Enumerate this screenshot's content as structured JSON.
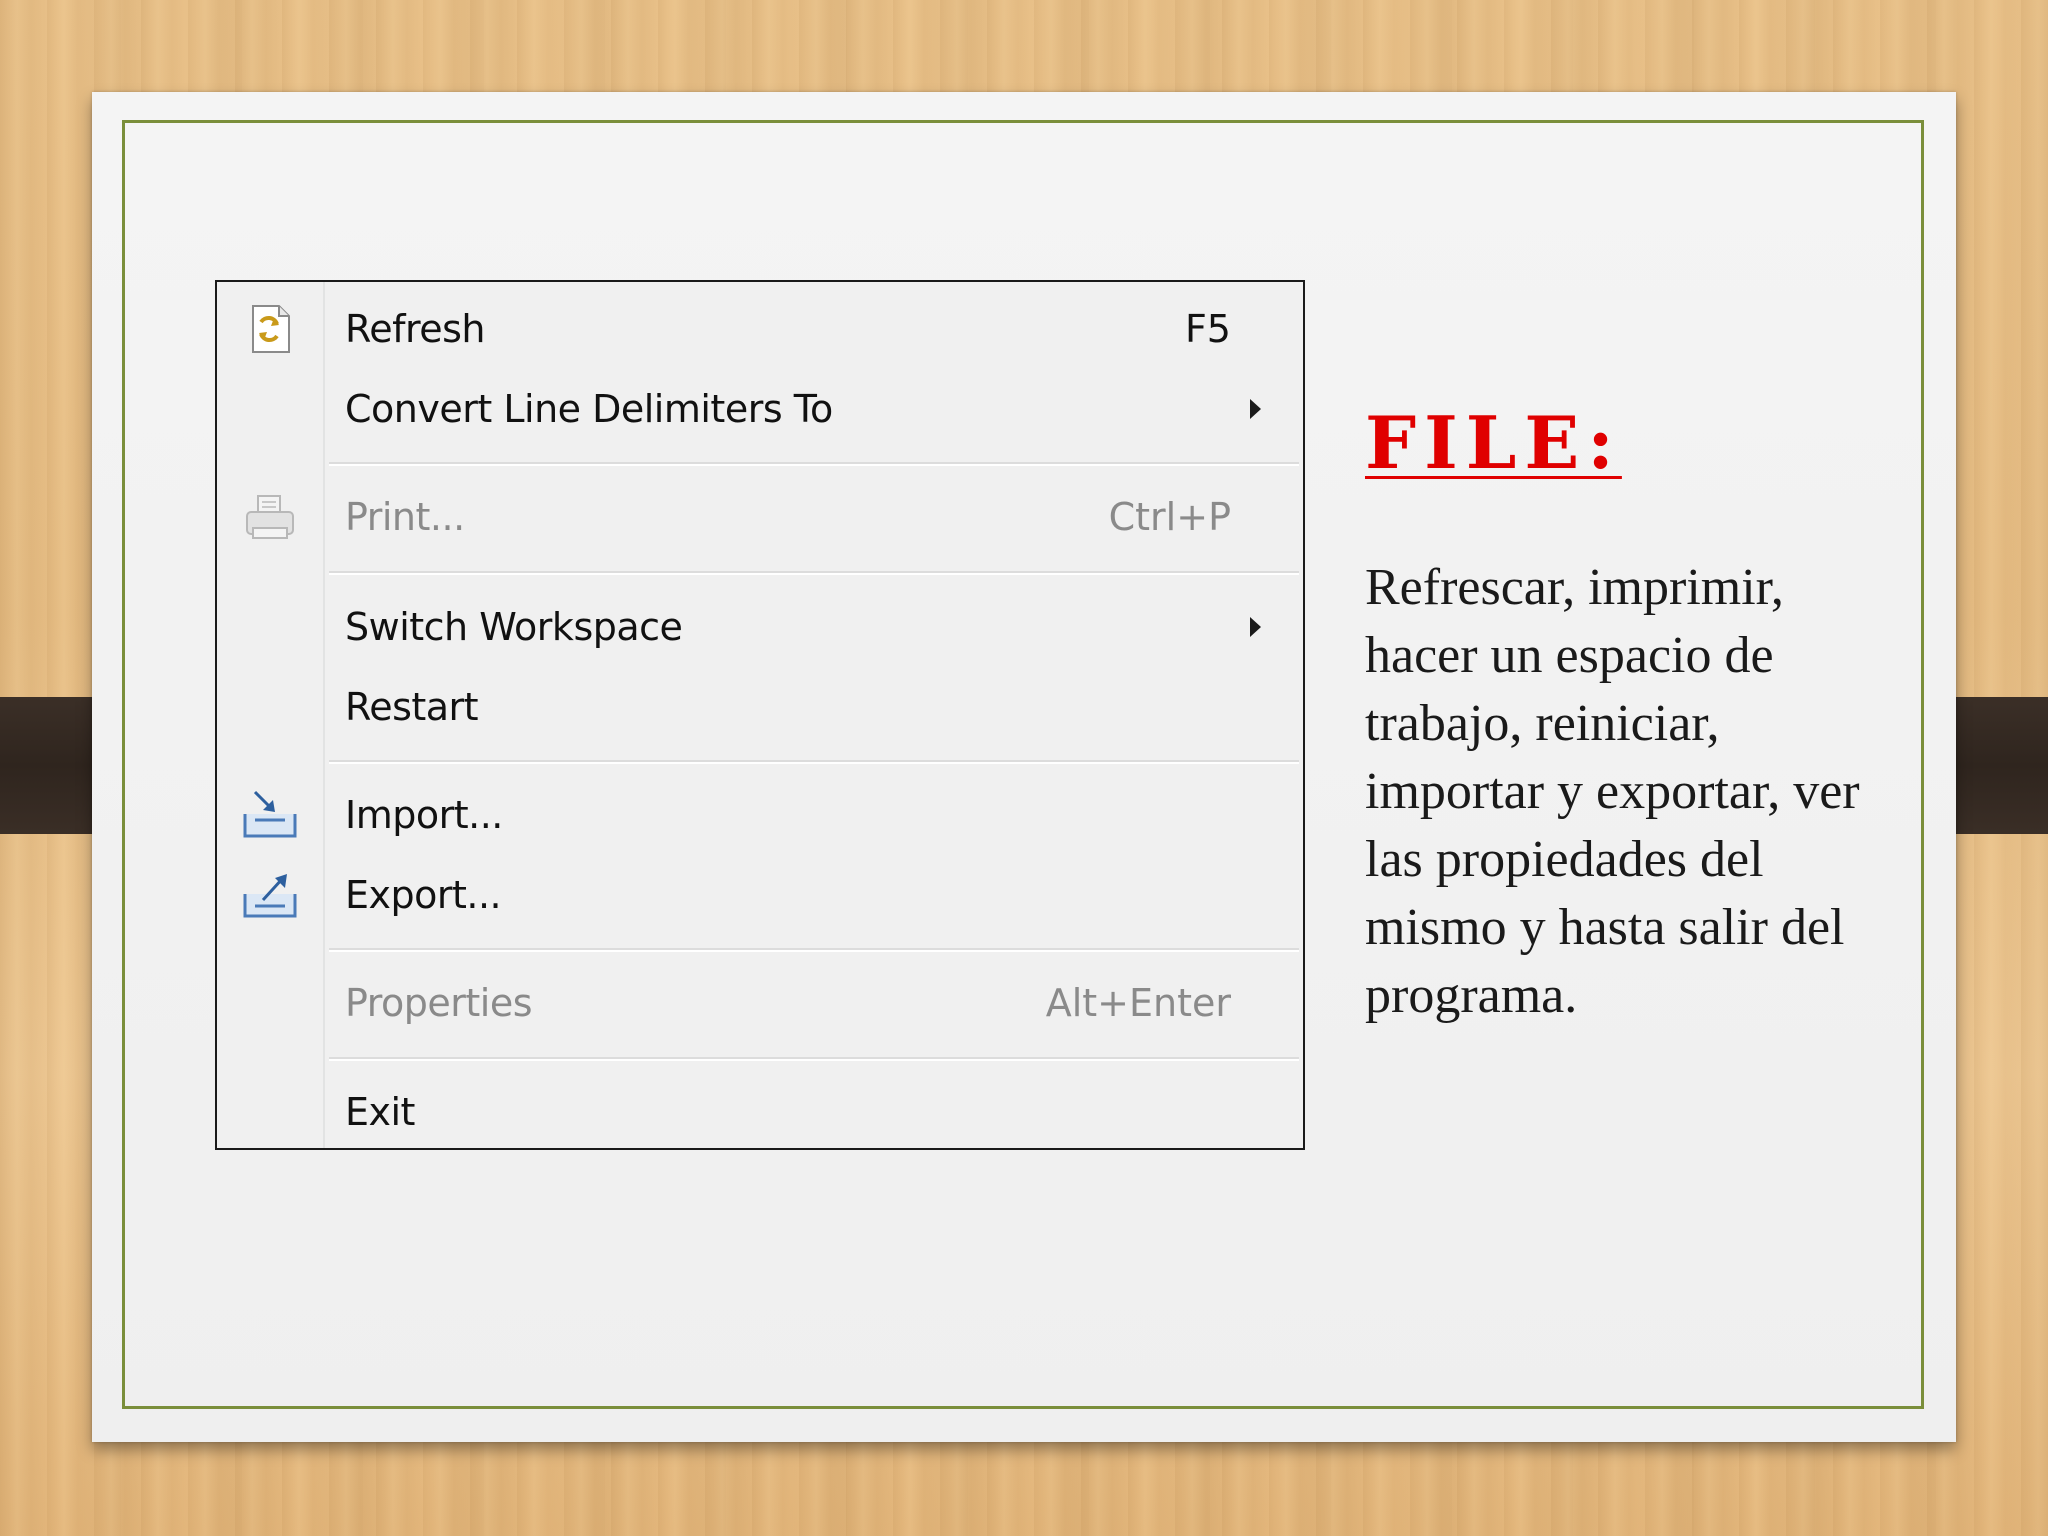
{
  "slide": {
    "heading": "FILE:",
    "description": "Refrescar, imprimir, hacer un espacio de trabajo, reiniciar, importar y exportar, ver las propiedades del mismo y hasta salir del programa."
  },
  "menu": {
    "items": [
      {
        "label": "Refresh",
        "shortcut": "F5",
        "icon": "refresh-icon",
        "enabled": true,
        "submenu": false
      },
      {
        "label": "Convert Line Delimiters To",
        "shortcut": "",
        "icon": "",
        "enabled": true,
        "submenu": true
      },
      {
        "label": "Print...",
        "shortcut": "Ctrl+P",
        "icon": "printer-icon",
        "enabled": false,
        "submenu": false
      },
      {
        "label": "Switch Workspace",
        "shortcut": "",
        "icon": "",
        "enabled": true,
        "submenu": true
      },
      {
        "label": "Restart",
        "shortcut": "",
        "icon": "",
        "enabled": true,
        "submenu": false
      },
      {
        "label": "Import...",
        "shortcut": "",
        "icon": "import-icon",
        "enabled": true,
        "submenu": false
      },
      {
        "label": "Export...",
        "shortcut": "",
        "icon": "export-icon",
        "enabled": true,
        "submenu": false
      },
      {
        "label": "Properties",
        "shortcut": "Alt+Enter",
        "icon": "",
        "enabled": false,
        "submenu": false
      },
      {
        "label": "Exit",
        "shortcut": "",
        "icon": "",
        "enabled": true,
        "submenu": false
      }
    ]
  },
  "colors": {
    "heading": "#e00000",
    "frame": "#7a8e3a",
    "disabled_text": "#8a8a8a"
  }
}
